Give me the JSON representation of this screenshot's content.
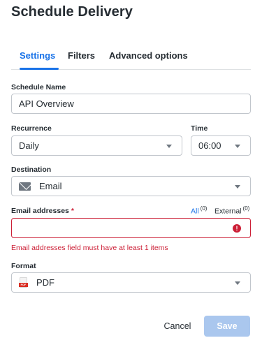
{
  "dialog": {
    "title": "Schedule Delivery"
  },
  "tabs": [
    {
      "label": "Settings",
      "active": true
    },
    {
      "label": "Filters",
      "active": false
    },
    {
      "label": "Advanced options",
      "active": false
    }
  ],
  "schedule_name": {
    "label": "Schedule Name",
    "value": "API Overview"
  },
  "recurrence": {
    "label": "Recurrence",
    "value": "Daily"
  },
  "time": {
    "label": "Time",
    "value": "06:00"
  },
  "destination": {
    "label": "Destination",
    "value": "Email",
    "icon": "envelope-icon"
  },
  "email_addresses": {
    "label": "Email addresses",
    "required_mark": "*",
    "value": "",
    "error": "Email addresses field must have at least 1 items",
    "all_label": "All",
    "all_count": "(0)",
    "external_label": "External",
    "external_count": "(0)"
  },
  "format": {
    "label": "Format",
    "value": "PDF",
    "icon": "pdf-file-icon",
    "icon_text": "PDF"
  },
  "footer": {
    "cancel_label": "Cancel",
    "save_label": "Save",
    "save_enabled": false
  },
  "colors": {
    "accent": "#1a73e8",
    "error": "#cc1f36",
    "save_disabled": "#aac7ee"
  }
}
